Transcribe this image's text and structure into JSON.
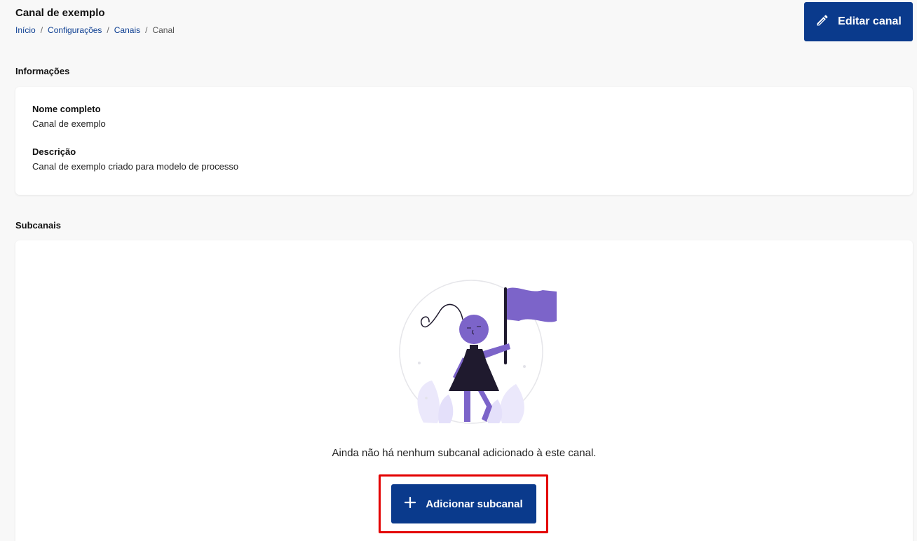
{
  "header": {
    "title": "Canal de exemplo",
    "breadcrumb": [
      "Início",
      "Configurações",
      "Canais",
      "Canal"
    ],
    "breadcrumb_separator": "/",
    "edit_button_label": "Editar canal",
    "edit_icon": "pencil-icon"
  },
  "info": {
    "section_title": "Informações",
    "fields": [
      {
        "label": "Nome completo",
        "value": "Canal de exemplo"
      },
      {
        "label": "Descrição",
        "value": "Canal de exemplo criado para modelo de processo"
      }
    ]
  },
  "subchannels": {
    "section_title": "Subcanais",
    "illustration": "empty-state-flag-illustration",
    "empty_message": "Ainda não há nenhum subcanal adicionado à este canal.",
    "add_button_label": "Adicionar subcanal",
    "add_icon": "plus-icon"
  },
  "colors": {
    "primary": "#0a3a8c",
    "illustration_accent": "#7c64c9",
    "highlight_border": "#e30000"
  }
}
